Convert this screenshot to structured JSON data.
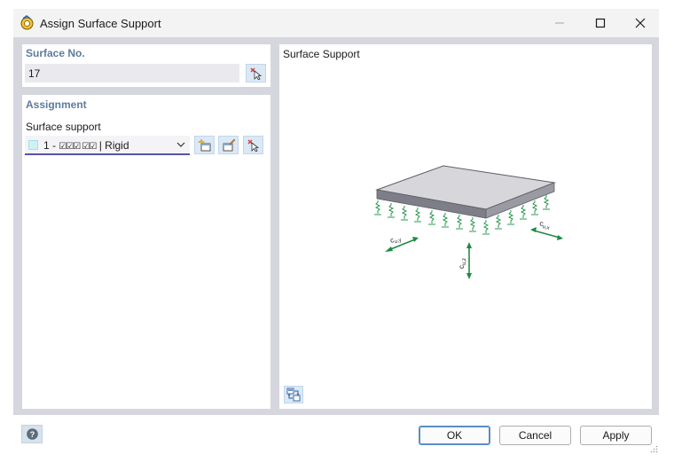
{
  "window": {
    "title": "Assign Surface Support",
    "app_icon": "rfem-app-icon",
    "controls": [
      "minimize-icon",
      "maximize-icon",
      "close-icon"
    ]
  },
  "surface": {
    "header": "Surface No.",
    "value": "17",
    "pick_icon": "pick-cursor-icon"
  },
  "assignment": {
    "header": "Assignment",
    "support_label": "Surface support",
    "selected": {
      "number": "1 -",
      "glyphs": "☑☑☑  ☑☑",
      "name": "| Rigid",
      "swatch_color": "#cdf1f5"
    },
    "buttons": [
      "new-icon",
      "edit-icon",
      "pick-cursor-icon"
    ]
  },
  "preview": {
    "title": "Surface Support",
    "axis_labels": {
      "cuy": "c",
      "cuy_sub": "u,y",
      "cux": "c",
      "cux_sub": "u,x",
      "cuz": "c",
      "cuz_sub": "u,z"
    },
    "plate_color": "#d7d7db",
    "edge_color": "#7e7e88",
    "spring_color": "#2e9a52",
    "view_tool_icon": "view-options-icon"
  },
  "footer": {
    "help_icon": "help-icon",
    "ok": "OK",
    "cancel": "Cancel",
    "apply": "Apply"
  }
}
